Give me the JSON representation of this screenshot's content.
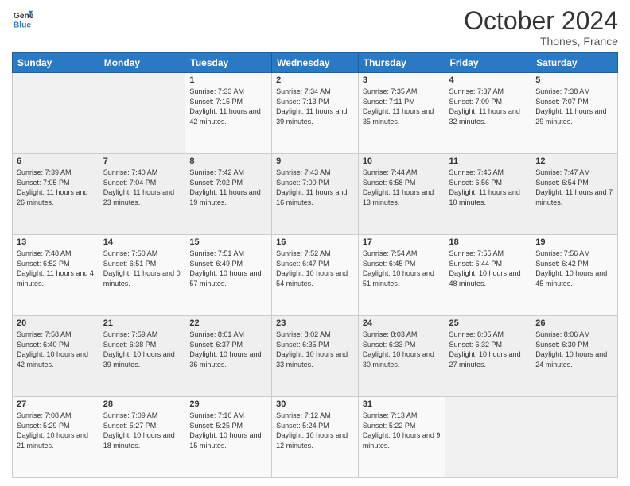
{
  "header": {
    "logo_line1": "General",
    "logo_line2": "Blue",
    "month": "October 2024",
    "location": "Thones, France"
  },
  "days_of_week": [
    "Sunday",
    "Monday",
    "Tuesday",
    "Wednesday",
    "Thursday",
    "Friday",
    "Saturday"
  ],
  "weeks": [
    [
      {
        "num": "",
        "sunrise": "",
        "sunset": "",
        "daylight": ""
      },
      {
        "num": "",
        "sunrise": "",
        "sunset": "",
        "daylight": ""
      },
      {
        "num": "1",
        "sunrise": "Sunrise: 7:33 AM",
        "sunset": "Sunset: 7:15 PM",
        "daylight": "Daylight: 11 hours and 42 minutes."
      },
      {
        "num": "2",
        "sunrise": "Sunrise: 7:34 AM",
        "sunset": "Sunset: 7:13 PM",
        "daylight": "Daylight: 11 hours and 39 minutes."
      },
      {
        "num": "3",
        "sunrise": "Sunrise: 7:35 AM",
        "sunset": "Sunset: 7:11 PM",
        "daylight": "Daylight: 11 hours and 35 minutes."
      },
      {
        "num": "4",
        "sunrise": "Sunrise: 7:37 AM",
        "sunset": "Sunset: 7:09 PM",
        "daylight": "Daylight: 11 hours and 32 minutes."
      },
      {
        "num": "5",
        "sunrise": "Sunrise: 7:38 AM",
        "sunset": "Sunset: 7:07 PM",
        "daylight": "Daylight: 11 hours and 29 minutes."
      }
    ],
    [
      {
        "num": "6",
        "sunrise": "Sunrise: 7:39 AM",
        "sunset": "Sunset: 7:05 PM",
        "daylight": "Daylight: 11 hours and 26 minutes."
      },
      {
        "num": "7",
        "sunrise": "Sunrise: 7:40 AM",
        "sunset": "Sunset: 7:04 PM",
        "daylight": "Daylight: 11 hours and 23 minutes."
      },
      {
        "num": "8",
        "sunrise": "Sunrise: 7:42 AM",
        "sunset": "Sunset: 7:02 PM",
        "daylight": "Daylight: 11 hours and 19 minutes."
      },
      {
        "num": "9",
        "sunrise": "Sunrise: 7:43 AM",
        "sunset": "Sunset: 7:00 PM",
        "daylight": "Daylight: 11 hours and 16 minutes."
      },
      {
        "num": "10",
        "sunrise": "Sunrise: 7:44 AM",
        "sunset": "Sunset: 6:58 PM",
        "daylight": "Daylight: 11 hours and 13 minutes."
      },
      {
        "num": "11",
        "sunrise": "Sunrise: 7:46 AM",
        "sunset": "Sunset: 6:56 PM",
        "daylight": "Daylight: 11 hours and 10 minutes."
      },
      {
        "num": "12",
        "sunrise": "Sunrise: 7:47 AM",
        "sunset": "Sunset: 6:54 PM",
        "daylight": "Daylight: 11 hours and 7 minutes."
      }
    ],
    [
      {
        "num": "13",
        "sunrise": "Sunrise: 7:48 AM",
        "sunset": "Sunset: 6:52 PM",
        "daylight": "Daylight: 11 hours and 4 minutes."
      },
      {
        "num": "14",
        "sunrise": "Sunrise: 7:50 AM",
        "sunset": "Sunset: 6:51 PM",
        "daylight": "Daylight: 11 hours and 0 minutes."
      },
      {
        "num": "15",
        "sunrise": "Sunrise: 7:51 AM",
        "sunset": "Sunset: 6:49 PM",
        "daylight": "Daylight: 10 hours and 57 minutes."
      },
      {
        "num": "16",
        "sunrise": "Sunrise: 7:52 AM",
        "sunset": "Sunset: 6:47 PM",
        "daylight": "Daylight: 10 hours and 54 minutes."
      },
      {
        "num": "17",
        "sunrise": "Sunrise: 7:54 AM",
        "sunset": "Sunset: 6:45 PM",
        "daylight": "Daylight: 10 hours and 51 minutes."
      },
      {
        "num": "18",
        "sunrise": "Sunrise: 7:55 AM",
        "sunset": "Sunset: 6:44 PM",
        "daylight": "Daylight: 10 hours and 48 minutes."
      },
      {
        "num": "19",
        "sunrise": "Sunrise: 7:56 AM",
        "sunset": "Sunset: 6:42 PM",
        "daylight": "Daylight: 10 hours and 45 minutes."
      }
    ],
    [
      {
        "num": "20",
        "sunrise": "Sunrise: 7:58 AM",
        "sunset": "Sunset: 6:40 PM",
        "daylight": "Daylight: 10 hours and 42 minutes."
      },
      {
        "num": "21",
        "sunrise": "Sunrise: 7:59 AM",
        "sunset": "Sunset: 6:38 PM",
        "daylight": "Daylight: 10 hours and 39 minutes."
      },
      {
        "num": "22",
        "sunrise": "Sunrise: 8:01 AM",
        "sunset": "Sunset: 6:37 PM",
        "daylight": "Daylight: 10 hours and 36 minutes."
      },
      {
        "num": "23",
        "sunrise": "Sunrise: 8:02 AM",
        "sunset": "Sunset: 6:35 PM",
        "daylight": "Daylight: 10 hours and 33 minutes."
      },
      {
        "num": "24",
        "sunrise": "Sunrise: 8:03 AM",
        "sunset": "Sunset: 6:33 PM",
        "daylight": "Daylight: 10 hours and 30 minutes."
      },
      {
        "num": "25",
        "sunrise": "Sunrise: 8:05 AM",
        "sunset": "Sunset: 6:32 PM",
        "daylight": "Daylight: 10 hours and 27 minutes."
      },
      {
        "num": "26",
        "sunrise": "Sunrise: 8:06 AM",
        "sunset": "Sunset: 6:30 PM",
        "daylight": "Daylight: 10 hours and 24 minutes."
      }
    ],
    [
      {
        "num": "27",
        "sunrise": "Sunrise: 7:08 AM",
        "sunset": "Sunset: 5:29 PM",
        "daylight": "Daylight: 10 hours and 21 minutes."
      },
      {
        "num": "28",
        "sunrise": "Sunrise: 7:09 AM",
        "sunset": "Sunset: 5:27 PM",
        "daylight": "Daylight: 10 hours and 18 minutes."
      },
      {
        "num": "29",
        "sunrise": "Sunrise: 7:10 AM",
        "sunset": "Sunset: 5:25 PM",
        "daylight": "Daylight: 10 hours and 15 minutes."
      },
      {
        "num": "30",
        "sunrise": "Sunrise: 7:12 AM",
        "sunset": "Sunset: 5:24 PM",
        "daylight": "Daylight: 10 hours and 12 minutes."
      },
      {
        "num": "31",
        "sunrise": "Sunrise: 7:13 AM",
        "sunset": "Sunset: 5:22 PM",
        "daylight": "Daylight: 10 hours and 9 minutes."
      },
      {
        "num": "",
        "sunrise": "",
        "sunset": "",
        "daylight": ""
      },
      {
        "num": "",
        "sunrise": "",
        "sunset": "",
        "daylight": ""
      }
    ]
  ]
}
